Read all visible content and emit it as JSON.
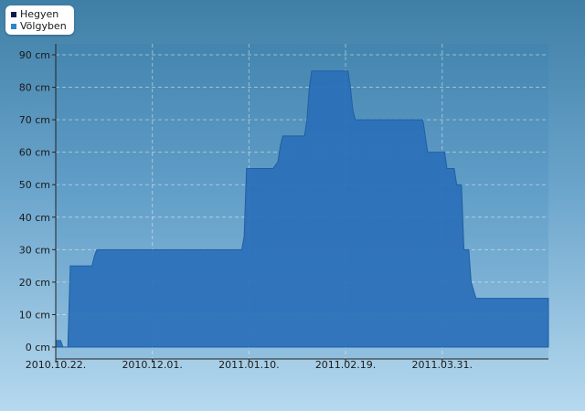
{
  "legend": {
    "items": [
      {
        "label": "Hegyen",
        "color": "#0d1b4c"
      },
      {
        "label": "Völgyben",
        "color": "#2f86c8"
      }
    ]
  },
  "chart_data": {
    "type": "area",
    "title": "",
    "xlabel": "",
    "ylabel": "",
    "x_ticks": [
      "2010.10.22.",
      "2010.12.01.",
      "2011.01.10.",
      "2011.02.19.",
      "2011.03.31."
    ],
    "y_ticks": [
      "0 cm",
      "10 cm",
      "20 cm",
      "30 cm",
      "40 cm",
      "50 cm",
      "60 cm",
      "70 cm",
      "80 cm",
      "90 cm"
    ],
    "ylim": [
      0,
      90
    ],
    "xlim": [
      "2010-10-22",
      "2011-05-14"
    ],
    "grid": true,
    "legend_position": "top-left",
    "series": [
      {
        "name": "Völgyben",
        "color": "#2a6fb8",
        "x": [
          "2010-10-22",
          "2010-10-24",
          "2010-10-25",
          "2010-10-27",
          "2010-10-28",
          "2010-11-06",
          "2010-11-07",
          "2010-11-08",
          "2010-11-09",
          "2011-01-07",
          "2011-01-08",
          "2011-01-09",
          "2011-01-10",
          "2011-01-20",
          "2011-01-22",
          "2011-01-23",
          "2011-01-24",
          "2011-02-02",
          "2011-02-03",
          "2011-02-04",
          "2011-02-05",
          "2011-02-20",
          "2011-02-21",
          "2011-02-22",
          "2011-02-23",
          "2011-03-23",
          "2011-03-24",
          "2011-03-25",
          "2011-03-26",
          "2011-04-01",
          "2011-04-02",
          "2011-04-05",
          "2011-04-06",
          "2011-04-08",
          "2011-04-09",
          "2011-04-11",
          "2011-04-12",
          "2011-04-14",
          "2011-04-15",
          "2011-05-14"
        ],
        "values": [
          2,
          2,
          0,
          0,
          25,
          25,
          28,
          30,
          30,
          30,
          34,
          55,
          55,
          55,
          57,
          62,
          65,
          65,
          70,
          80,
          85,
          85,
          80,
          73,
          70,
          70,
          65,
          60,
          60,
          60,
          55,
          55,
          50,
          50,
          30,
          30,
          20,
          15,
          15,
          15
        ]
      }
    ]
  }
}
